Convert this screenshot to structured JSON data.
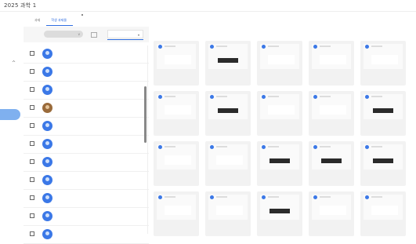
{
  "window": {
    "title": "2025 과학 1"
  },
  "tabs": [
    {
      "label": "과제"
    },
    {
      "label": "학생 과제물"
    }
  ],
  "filter": {
    "chip_label": "",
    "select_label": ""
  },
  "students": [
    {
      "name": "",
      "subtitle": "",
      "value": ""
    },
    {
      "name": "",
      "subtitle": "",
      "value": ""
    },
    {
      "name": "",
      "subtitle": "",
      "value": ""
    },
    {
      "name": "",
      "subtitle": "",
      "value": ""
    },
    {
      "name": "",
      "subtitle": "",
      "value": ""
    },
    {
      "name": "",
      "subtitle": "",
      "value": ""
    },
    {
      "name": "",
      "subtitle": "",
      "value": ""
    },
    {
      "name": "",
      "subtitle": "",
      "value": ""
    },
    {
      "name": "",
      "subtitle": "",
      "value": ""
    },
    {
      "name": "",
      "subtitle": "",
      "value": ""
    },
    {
      "name": "",
      "subtitle": "",
      "value": ""
    }
  ],
  "cards": [
    {
      "kind": "plain"
    },
    {
      "kind": "dark"
    },
    {
      "kind": "plain"
    },
    {
      "kind": "plain"
    },
    {
      "kind": "plain"
    },
    {
      "kind": "plain"
    },
    {
      "kind": "dark"
    },
    {
      "kind": "plain"
    },
    {
      "kind": "plain"
    },
    {
      "kind": "dark"
    },
    {
      "kind": "plain"
    },
    {
      "kind": "plain"
    },
    {
      "kind": "dark"
    },
    {
      "kind": "dark"
    },
    {
      "kind": "dark"
    },
    {
      "kind": "plain"
    },
    {
      "kind": "plain"
    },
    {
      "kind": "dark"
    },
    {
      "kind": "plain"
    },
    {
      "kind": "plain"
    }
  ]
}
